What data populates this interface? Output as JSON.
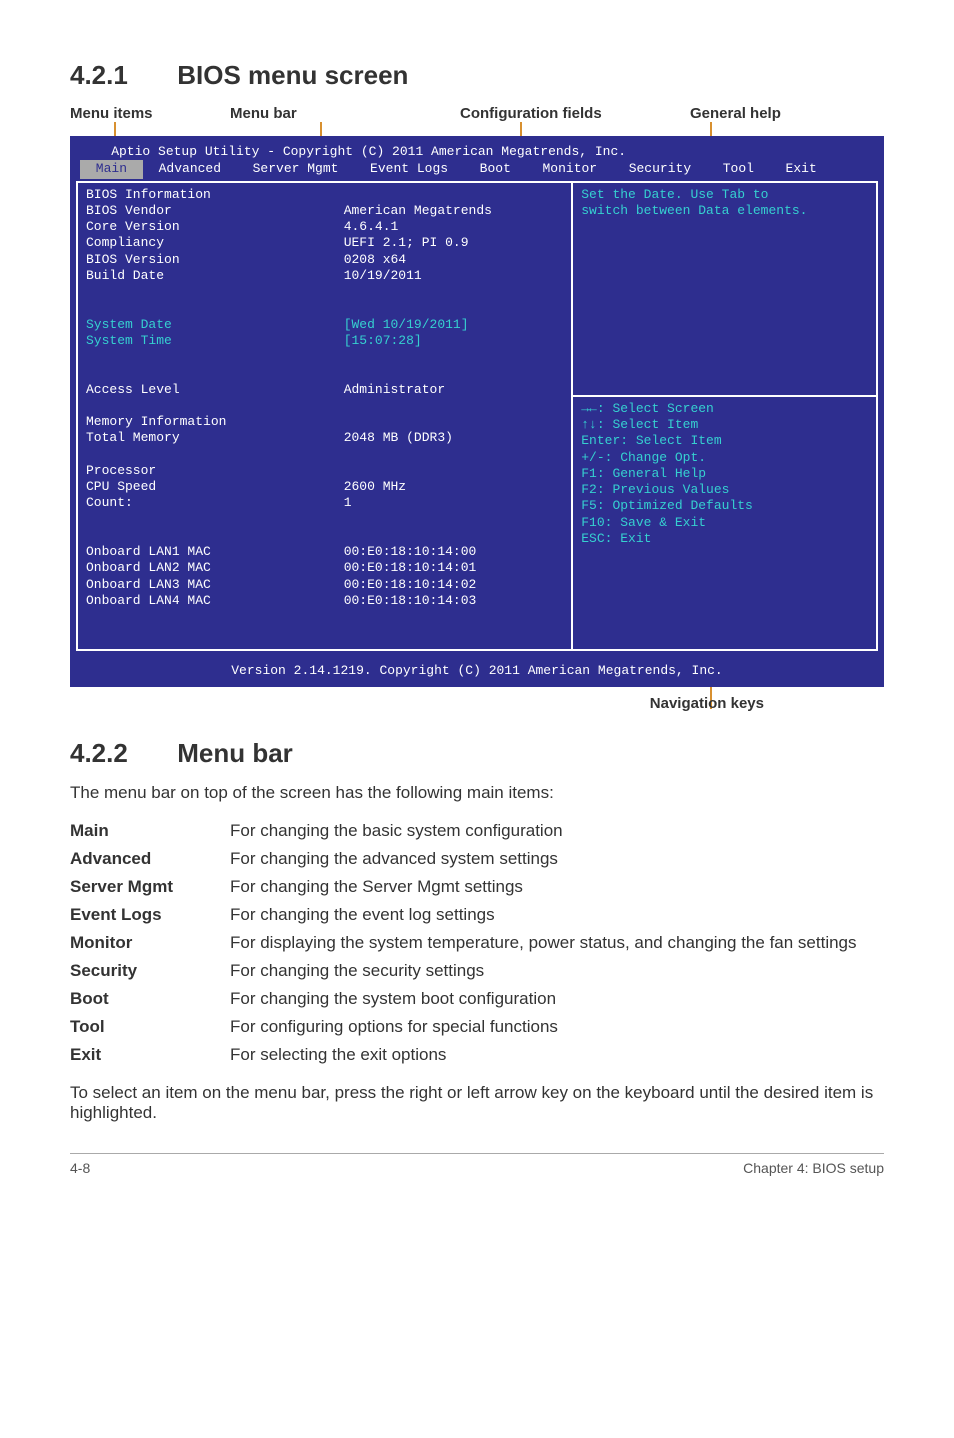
{
  "section1": {
    "num": "4.2.1",
    "title": "BIOS menu screen"
  },
  "labels": {
    "menu_items": "Menu items",
    "menu_bar": "Menu bar",
    "config_fields": "Configuration fields",
    "general_help": "General help",
    "nav_keys": "Navigation keys"
  },
  "bios": {
    "title": "    Aptio Setup Utility - Copyright (C) 2011 American Megatrends, Inc.",
    "tabs": [
      "Main",
      "Advanced",
      "Server Mgmt",
      "Event Logs",
      "Boot",
      "Monitor",
      "Security",
      "Tool",
      "Exit"
    ],
    "left_rows": [
      {
        "k": "BIOS Information",
        "v": ""
      },
      {
        "k": "BIOS Vendor",
        "v": "American Megatrends"
      },
      {
        "k": "Core Version",
        "v": "4.6.4.1"
      },
      {
        "k": "Compliancy",
        "v": "UEFI 2.1; PI 0.9"
      },
      {
        "k": "BIOS Version",
        "v": "0208 x64"
      },
      {
        "k": "Build Date",
        "v": "10/19/2011"
      },
      {
        "k": "",
        "v": ""
      },
      {
        "k": "",
        "v": ""
      },
      {
        "k": "System Date",
        "v": "[Wed 10/19/2011]",
        "teal": true
      },
      {
        "k": "System Time",
        "v": "[15:07:28]",
        "teal": true
      },
      {
        "k": "",
        "v": ""
      },
      {
        "k": "",
        "v": ""
      },
      {
        "k": "Access Level",
        "v": "Administrator"
      },
      {
        "k": "",
        "v": ""
      },
      {
        "k": "Memory Information",
        "v": ""
      },
      {
        "k": "Total Memory",
        "v": "2048 MB (DDR3)"
      },
      {
        "k": "",
        "v": ""
      },
      {
        "k": "Processor",
        "v": ""
      },
      {
        "k": "CPU Speed",
        "v": "2600 MHz"
      },
      {
        "k": "Count:",
        "v": "1"
      },
      {
        "k": "",
        "v": ""
      },
      {
        "k": "",
        "v": ""
      },
      {
        "k": "Onboard LAN1 MAC",
        "v": "00:E0:18:10:14:00"
      },
      {
        "k": "Onboard LAN2 MAC",
        "v": "00:E0:18:10:14:01"
      },
      {
        "k": "Onboard LAN3 MAC",
        "v": "00:E0:18:10:14:02"
      },
      {
        "k": "Onboard LAN4 MAC",
        "v": "00:E0:18:10:14:03"
      }
    ],
    "help_top": [
      "Set the Date. Use Tab to",
      "switch between Data elements."
    ],
    "help_bot": [
      "→←: Select Screen",
      "↑↓:  Select Item",
      "Enter: Select Item",
      "+/-: Change Opt.",
      "F1: General Help",
      "F2: Previous Values",
      "F5: Optimized Defaults",
      "F10: Save & Exit",
      "ESC: Exit"
    ],
    "footer": "Version 2.14.1219. Copyright (C) 2011 American Megatrends, Inc."
  },
  "section2": {
    "num": "4.2.2",
    "title": "Menu bar"
  },
  "intro": "The menu bar on top of the screen has the following main items:",
  "items": [
    {
      "k": "Main",
      "v": "For changing the basic system configuration"
    },
    {
      "k": "Advanced",
      "v": "For changing the advanced system settings"
    },
    {
      "k": "Server Mgmt",
      "v": "For changing the Server Mgmt settings"
    },
    {
      "k": "Event Logs",
      "v": "For changing the event log settings"
    },
    {
      "k": "Monitor",
      "v": "For displaying the system temperature, power status, and changing the fan settings"
    },
    {
      "k": "Security",
      "v": "For changing the security settings"
    },
    {
      "k": "Boot",
      "v": "For changing the system boot configuration"
    },
    {
      "k": "Tool",
      "v": "For configuring options for special functions"
    },
    {
      "k": "Exit",
      "v": "For selecting the exit options"
    }
  ],
  "outro": "To select an item on the menu bar, press the right or left arrow key on the keyboard until the desired item is highlighted.",
  "footer": {
    "left": "4-8",
    "right": "Chapter 4: BIOS setup"
  }
}
